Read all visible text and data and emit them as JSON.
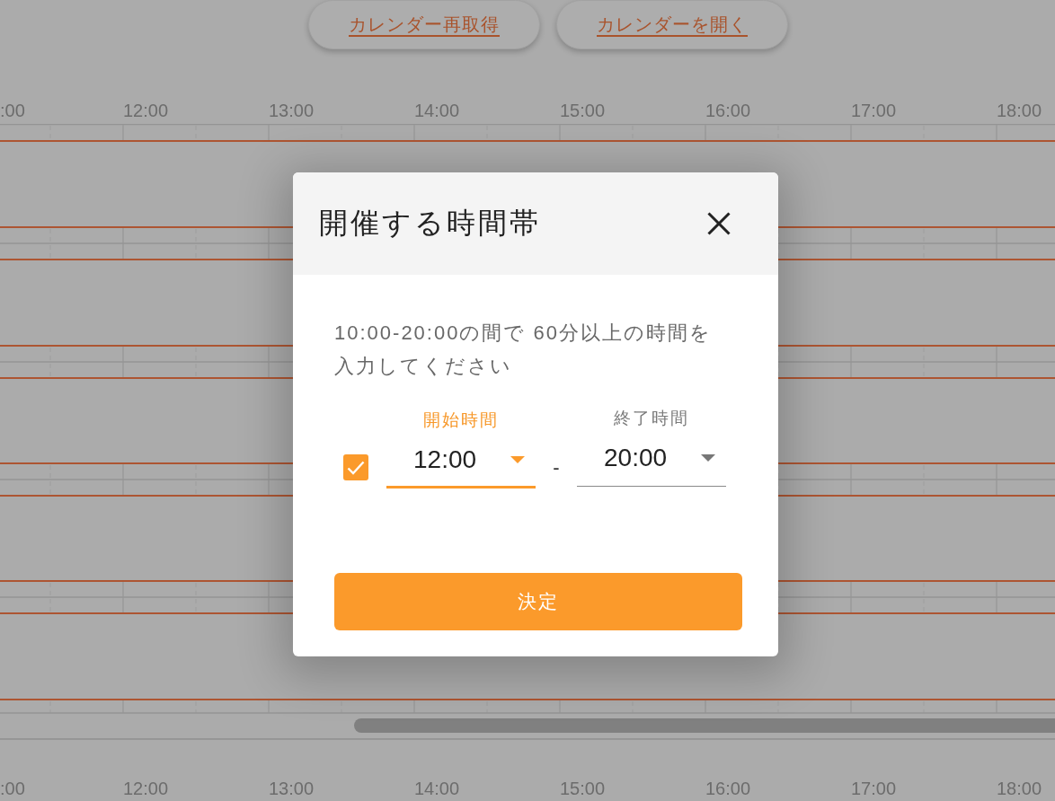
{
  "toolbar": {
    "buttons": [
      {
        "label": "カレンダー再取得"
      },
      {
        "label": "カレンダーを開く"
      }
    ]
  },
  "timeline": {
    "hours_top": [
      ":00",
      "12:00",
      "13:00",
      "14:00",
      "15:00",
      "16:00",
      "17:00",
      "18:00"
    ],
    "hours_bottom": [
      ":00",
      "12:00",
      "13:00",
      "14:00",
      "15:00",
      "16:00",
      "17:00",
      "18:00"
    ]
  },
  "dialog": {
    "title": "開催する時間帯",
    "message": "10:00-20:00の間で 60分以上の時間を入力してください",
    "enabled": {
      "checked": true
    },
    "time_fields": [
      {
        "label": "開始時間",
        "value": "12:00",
        "focused": true
      },
      {
        "label": "終了時間",
        "value": "20:00",
        "focused": false
      }
    ],
    "separator": "-",
    "submit": "決定"
  }
}
